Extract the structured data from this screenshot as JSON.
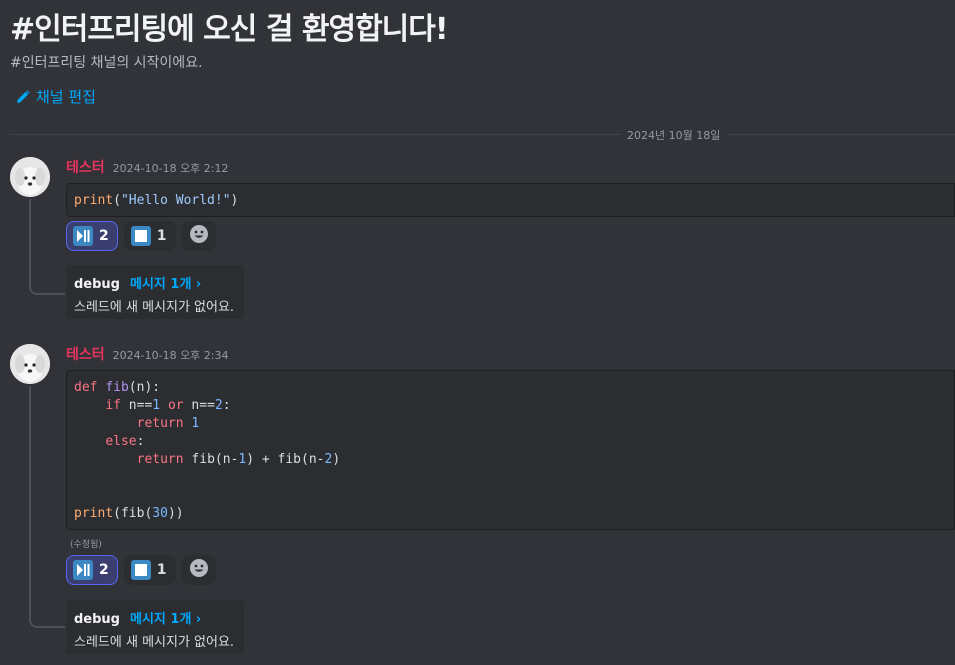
{
  "welcome": {
    "title": "#인터프리팅에 오신 걸 환영합니다!",
    "subtitle": "#인터프리팅 채널의 시작이에요.",
    "edit_label": "채널 편집"
  },
  "date_divider": "2024년 10월 18일",
  "colors": {
    "accent": "#00a8fc",
    "author": "#e8345e",
    "background": "#313338",
    "active_reaction": "#5865f2"
  },
  "messages": [
    {
      "author": "테스터",
      "timestamp": "2024-10-18 오후 2:12",
      "edited": "",
      "code_lines": [
        "print(\"Hello World!\")"
      ],
      "reactions": [
        {
          "icon": "play-pause-icon",
          "count": "2",
          "active": true
        },
        {
          "icon": "stop-icon",
          "count": "1",
          "active": false
        }
      ],
      "thread": {
        "name": "debug",
        "count": "메시지 1개 ›",
        "empty": "스레드에 새 메시지가 없어요."
      }
    },
    {
      "author": "테스터",
      "timestamp": "2024-10-18 오후 2:34",
      "edited": "(수정됨)",
      "code_lines": [
        "def fib(n):",
        "    if n==1 or n==2:",
        "        return 1",
        "    else:",
        "        return fib(n-1) + fib(n-2)",
        "",
        "",
        "print(fib(30))"
      ],
      "reactions": [
        {
          "icon": "play-pause-icon",
          "count": "2",
          "active": true
        },
        {
          "icon": "stop-icon",
          "count": "1",
          "active": false
        }
      ],
      "thread": {
        "name": "debug",
        "count": "메시지 1개 ›",
        "empty": "스레드에 새 메시지가 없어요."
      }
    }
  ]
}
